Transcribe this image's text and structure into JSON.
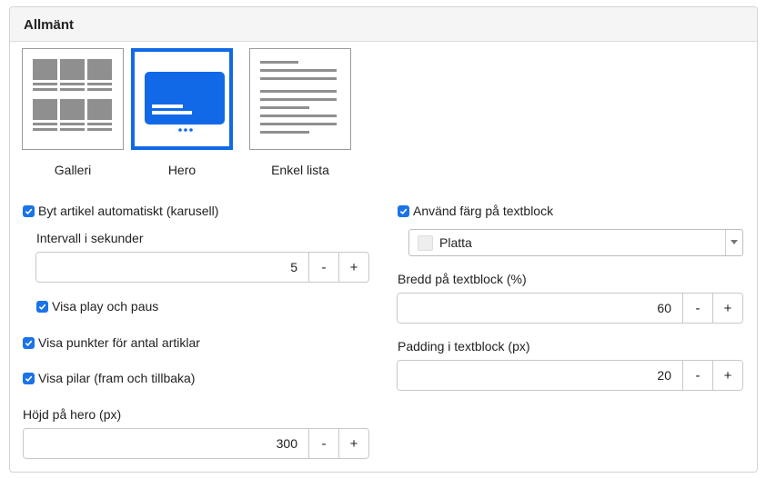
{
  "panel": {
    "title": "Allmänt"
  },
  "layouts": [
    {
      "label": "Galleri",
      "selected": false
    },
    {
      "label": "Hero",
      "selected": true
    },
    {
      "label": "Enkel lista",
      "selected": false
    }
  ],
  "left": {
    "autorotate": {
      "label": "Byt artikel automatiskt (karusell)",
      "checked": true
    },
    "interval": {
      "label": "Intervall i sekunder",
      "value": "5",
      "minus": "-",
      "plus": "+"
    },
    "playpause": {
      "label": "Visa play och paus",
      "checked": true
    },
    "dots": {
      "label": "Visa punkter för antal artiklar",
      "checked": true
    },
    "arrows": {
      "label": "Visa pilar (fram och tillbaka)",
      "checked": true
    },
    "height": {
      "label": "Höjd på hero (px)",
      "value": "300",
      "minus": "-",
      "plus": "+"
    }
  },
  "right": {
    "usecolor": {
      "label": "Använd färg på textblock",
      "checked": true
    },
    "color_select": {
      "value": "Platta",
      "swatch_color": "#eeeeee"
    },
    "width": {
      "label": "Bredd på textblock (%)",
      "value": "60",
      "minus": "-",
      "plus": "+"
    },
    "padding": {
      "label": "Padding i textblock (px)",
      "value": "20",
      "minus": "-",
      "plus": "+"
    }
  },
  "icons": {
    "checkbox": "checkmark-icon",
    "caret": "caret-down-icon"
  },
  "colors": {
    "accent": "#1a73e8",
    "selected_border": "#1169e8",
    "thumb_gray": "#8f8f8f"
  }
}
